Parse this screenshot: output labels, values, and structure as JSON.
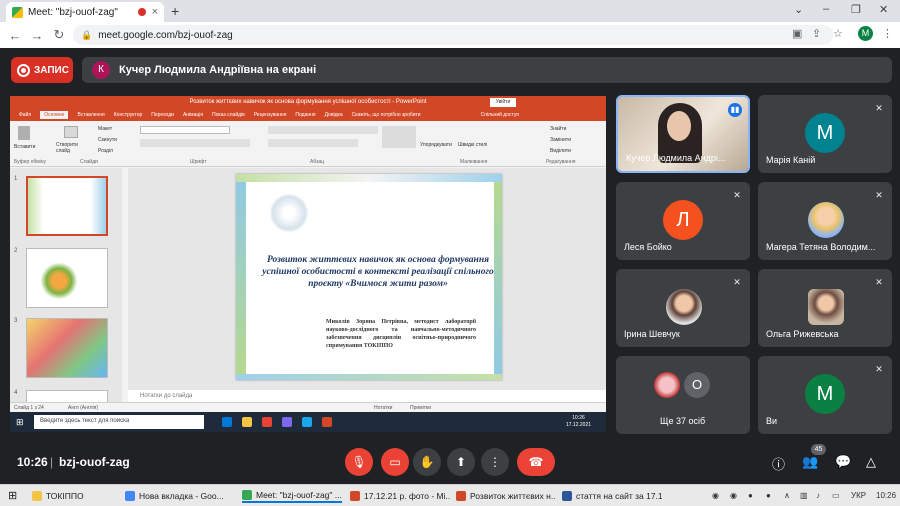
{
  "browser": {
    "tab_title": "Meet: \"bzj-ouof-zag\"",
    "tab_close": "×",
    "new_tab": "+",
    "url": "meet.google.com/bzj-ouof-zag",
    "profile_initial": "M",
    "window_controls": [
      "⌄",
      "–",
      "❐",
      "✕"
    ]
  },
  "meet": {
    "record_label": "ЗАПИС",
    "presenter_initial": "К",
    "presenter_banner": "Кучер Людмила Андріївна на екрані",
    "time": "10:26",
    "separator": "|",
    "meeting_code": "bzj-ouof-zag",
    "participants_count": "45",
    "participants": [
      {
        "name": "Кучер Людмила Андрі...",
        "kind": "video"
      },
      {
        "name": "Марія Каній",
        "initial": "М",
        "color": "#00838f"
      },
      {
        "name": "Леся Бойко",
        "initial": "Л",
        "color": "#f4511e"
      },
      {
        "name": "Магера Тетяна Володим...",
        "kind": "photo"
      },
      {
        "name": "Ірина Шевчук",
        "kind": "photo"
      },
      {
        "name": "Ольга Рижевська",
        "kind": "photo"
      },
      {
        "name": "Ще 37 осіб",
        "initial": "О",
        "color": "#5f6368"
      },
      {
        "name": "Ви",
        "initial": "М",
        "color": "#0b8043"
      }
    ]
  },
  "presentation": {
    "window_title": "Розвиток життєвих навичок як основа формування успішної особистості - PowerPoint",
    "signin_button": "Увійти",
    "ribbon_tabs": [
      "Файл",
      "Основне",
      "Вставлення",
      "Конструктор",
      "Переходи",
      "Анімація",
      "Показ слайдів",
      "Рецензування",
      "Подання",
      "Довідка",
      "Скажіть, що потрібно зробити",
      "Спільний доступ"
    ],
    "ribbon_labels": {
      "paste": "Вставити",
      "new_slide": "Створити слайд",
      "layout": "Макет",
      "reset": "Скинути",
      "section": "Розділ",
      "arrange": "Упорядкувати",
      "quick_styles": "Швидкі стилі",
      "find": "Знайти",
      "replace": "Замінити",
      "select": "Виділити",
      "group_clipboard": "Буфер обміну",
      "group_slides": "Слайди",
      "group_font": "Шрифт",
      "group_paragraph": "Абзац",
      "group_drawing": "Малювання",
      "group_editing": "Редагування"
    },
    "slide_numbers": [
      "1",
      "2",
      "3",
      "4"
    ],
    "slide_title": "Розвиток життєвих навичок як основа формування успішної особистості в контексті реалізації спільного проєкту «Вчимося жити разом»",
    "slide_author": "Миколів Зоряна Петрівна, методист лабораторії науково-дослідного та навчально-методичного забезпечення дисциплін освітньо-природничого спрямування ТОКІППО",
    "notes_placeholder": "Нотатки до слайда",
    "status_left": "Слайд 1 з 24",
    "status_lang": "Англ (Англія)",
    "status_notes": "Нотатки",
    "status_comments": "Примітки",
    "win_search": "Введите здесь текст для поиска",
    "win_lang": "УКР",
    "win_time": "10:26",
    "win_date": "17.12.2021"
  },
  "taskbar": {
    "items": [
      {
        "label": "ТОКІППО",
        "color": "#f4c542"
      },
      {
        "label": "Нова вкладка - Goo...",
        "color": "#4285f4"
      },
      {
        "label": "Meet: \"bzj-ouof-zag\" ...",
        "color": "#34a853"
      },
      {
        "label": "17.12.21 р. фото - Mi...",
        "color": "#d24726"
      },
      {
        "label": "Розвиток життєвих н...",
        "color": "#d24726"
      },
      {
        "label": "стаття на сайт за 17.1...",
        "color": "#2b579a"
      }
    ],
    "lang": "УКР",
    "time": "10:26"
  }
}
